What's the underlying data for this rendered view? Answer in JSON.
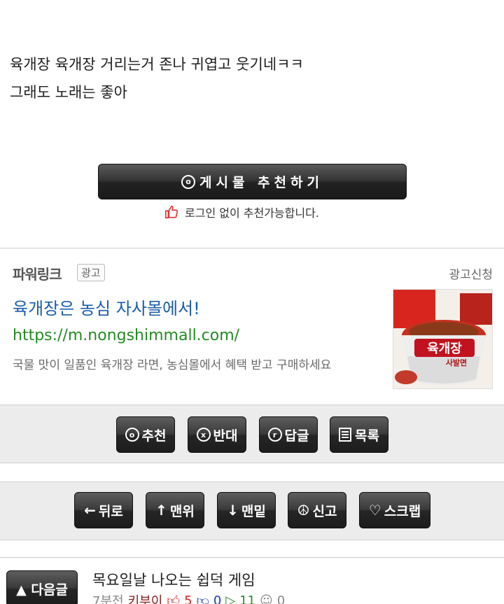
{
  "post": {
    "line1": "육개장 육개장 거리는거 존나 귀엽고 웃기네ㅋㅋ",
    "line2": "그래도 노래는 좋아"
  },
  "recommend": {
    "label": "게시물 추천하기",
    "icon": "circled-o-icon",
    "no_login_text": "로그인 없이 추천가능합니다."
  },
  "ad": {
    "label": "파워링크",
    "badge": "광고",
    "apply": "광고신청",
    "title": "육개장은 농심 자사몰에서!",
    "url": "https://m.nongshimmall.com/",
    "description": "국물 맛이 일품인 육개장 라면, 농심몰에서 혜택 받고 구매하세요",
    "thumb_brand": "육개장",
    "thumb_sub": "사발면"
  },
  "actions1": [
    {
      "icon": "o",
      "label": "추천"
    },
    {
      "icon": "x",
      "label": "반대"
    },
    {
      "icon": "r",
      "label": "답글"
    },
    {
      "icon": "list",
      "label": "목록"
    }
  ],
  "actions2": [
    {
      "glyph": "←",
      "label": "뒤로"
    },
    {
      "glyph": "↑",
      "label": "맨위"
    },
    {
      "glyph": "↓",
      "label": "맨밑"
    },
    {
      "glyph": "☮",
      "label": "신고"
    },
    {
      "glyph": "♡",
      "label": "스크랩"
    }
  ],
  "next": {
    "button": "▲ 다음글",
    "title": "목요일날 나오는 쉽덕 게임",
    "time": "7분전",
    "author": "키부이",
    "up": "5",
    "down": "0",
    "views": "11",
    "comments": "0"
  },
  "colors": {
    "link": "#1a5dab",
    "url": "#228b22",
    "button_dark": "#2a2a2a"
  }
}
